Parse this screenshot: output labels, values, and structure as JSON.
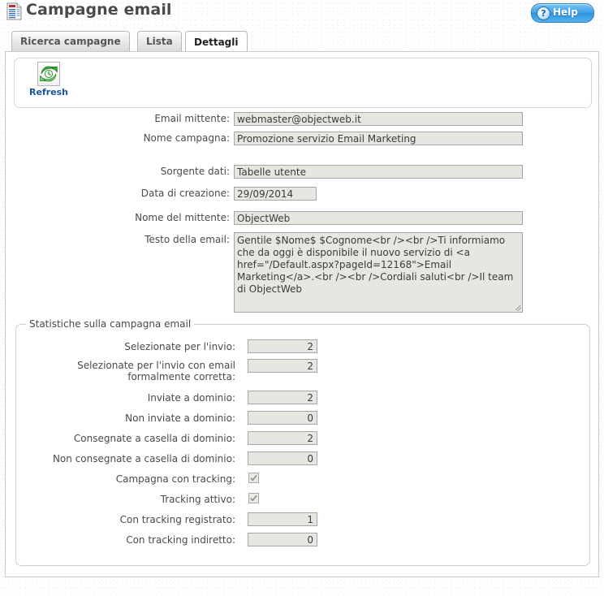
{
  "header": {
    "title": "Campagne email",
    "title_icon": "report-document-icon",
    "help_label": "Help",
    "help_icon": "question-mark-icon"
  },
  "tabs": [
    {
      "label": "Ricerca campagne",
      "active": false
    },
    {
      "label": "Lista",
      "active": false
    },
    {
      "label": "Dettagli",
      "active": true
    }
  ],
  "toolbar": {
    "refresh_label": "Refresh",
    "refresh_icon": "refresh-circular-arrows-icon"
  },
  "form": {
    "fields": [
      {
        "label": "Email mittente:",
        "value": "webmaster@objectweb.it",
        "type": "text",
        "width": "wide"
      },
      {
        "label": "Nome campagna:",
        "value": "Promozione servizio Email Marketing",
        "type": "text",
        "width": "wide"
      },
      {
        "label": "Sorgente dati:",
        "value": "Tabelle utente",
        "type": "text",
        "width": "wide"
      },
      {
        "label": "Data di creazione:",
        "value": "29/09/2014",
        "type": "text",
        "width": "date"
      },
      {
        "label": "Nome del mittente:",
        "value": "ObjectWeb",
        "type": "text",
        "width": "wide"
      },
      {
        "label": "Testo della email:",
        "value": "Gentile $Nome$ $Cognome<br /><br />Ti informiamo che da oggi è disponibile il nuovo servizio di <a href=\"/Default.aspx?pageId=12168\">Email Marketing</a>.<br /><br />Cordiali saluti<br />Il team di ObjectWeb",
        "type": "textarea"
      }
    ]
  },
  "stats": {
    "legend": "Statistiche sulla campagna email",
    "rows": [
      {
        "label": "Selezionate per l'invio:",
        "value": "2",
        "type": "text"
      },
      {
        "label": "Selezionate per l'invio con email formalmente corretta:",
        "value": "2",
        "type": "text",
        "tall": true
      },
      {
        "label": "Inviate a dominio:",
        "value": "2",
        "type": "text"
      },
      {
        "label": "Non inviate a dominio:",
        "value": "0",
        "type": "text"
      },
      {
        "label": "Consegnate a casella di dominio:",
        "value": "2",
        "type": "text"
      },
      {
        "label": "Non consegnate a casella di dominio:",
        "value": "0",
        "type": "text"
      },
      {
        "label": "Campagna con tracking:",
        "value": "",
        "type": "checkbox",
        "checked": true
      },
      {
        "label": "Tracking attivo:",
        "value": "",
        "type": "checkbox",
        "checked": true
      },
      {
        "label": "Con tracking registrato:",
        "value": "1",
        "type": "text"
      },
      {
        "label": "Con tracking indiretto:",
        "value": "0",
        "type": "text"
      }
    ]
  },
  "colors": {
    "accent_blue": "#3da2e8",
    "link_blue": "#17559c",
    "field_bg": "#e7e7e2",
    "field_border": "#a6a6a6",
    "panel_border": "#c9c9c9",
    "title_gray": "#4a4a4a"
  }
}
